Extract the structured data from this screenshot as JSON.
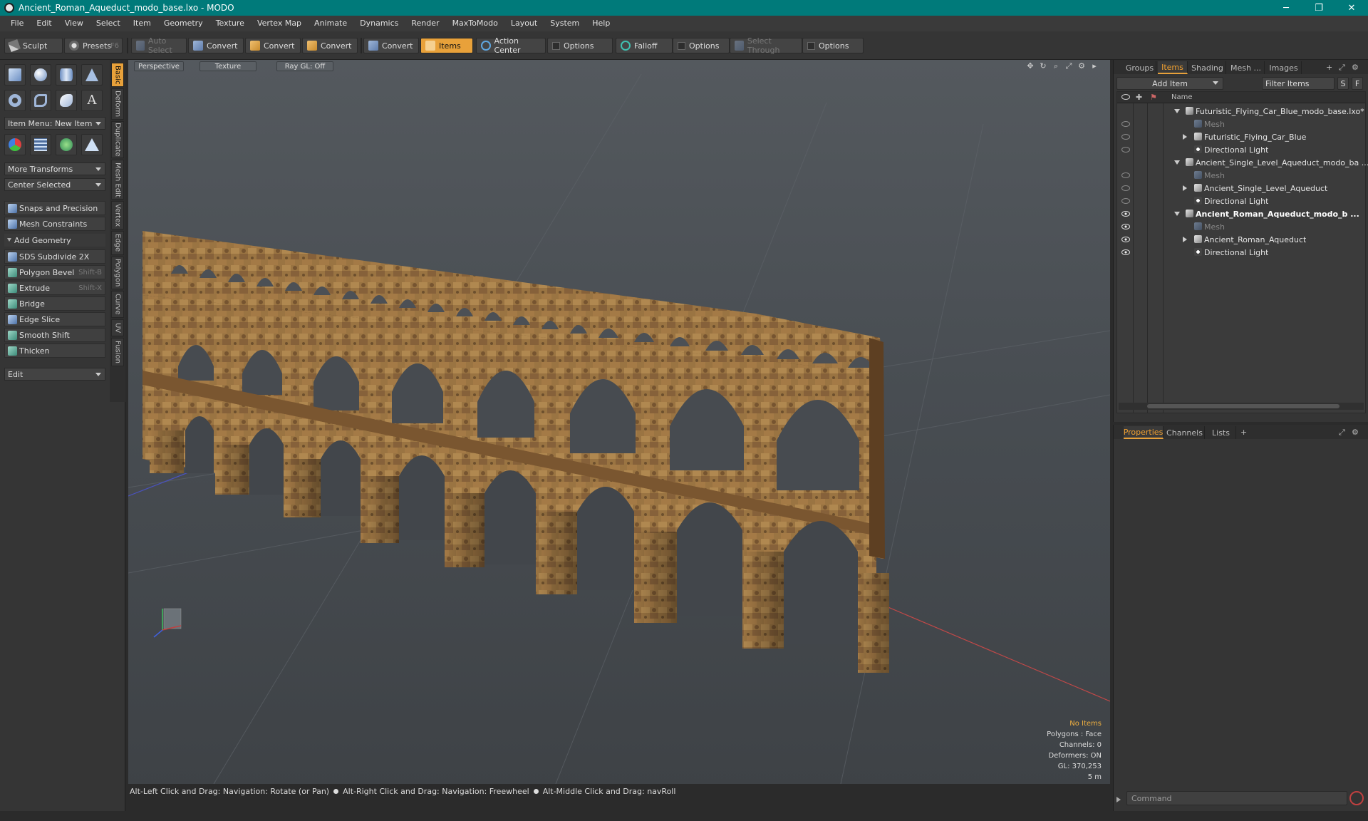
{
  "window": {
    "title": "Ancient_Roman_Aqueduct_modo_base.lxo - MODO",
    "minimize": "─",
    "maximize": "❐",
    "close": "✕"
  },
  "menu": [
    "File",
    "Edit",
    "View",
    "Select",
    "Item",
    "Geometry",
    "Texture",
    "Vertex Map",
    "Animate",
    "Dynamics",
    "Render",
    "MaxToModo",
    "Layout",
    "System",
    "Help"
  ],
  "toolbar": {
    "sculpt": "Sculpt",
    "presets": "Presets",
    "presets_key": "F6",
    "auto_select": "Auto Select",
    "convert1": "Convert",
    "convert2": "Convert",
    "convert3": "Convert",
    "convert4": "Convert",
    "items": "Items",
    "action_center": "Action Center",
    "options1": "Options",
    "falloff": "Falloff",
    "options2": "Options",
    "select_through": "Select Through",
    "options3": "Options"
  },
  "left_panel": {
    "item_menu": "Item Menu: New Item",
    "more_transforms": "More Transforms",
    "center_selected": "Center Selected",
    "snaps": "Snaps and Precision",
    "mesh_constraints": "Mesh Constraints",
    "add_geometry": "Add Geometry",
    "tools": [
      {
        "label": "SDS Subdivide 2X",
        "shortcut": ""
      },
      {
        "label": "Polygon Bevel",
        "shortcut": "Shift-B"
      },
      {
        "label": "Extrude",
        "shortcut": "Shift-X"
      },
      {
        "label": "Bridge",
        "shortcut": ""
      },
      {
        "label": "Edge Slice",
        "shortcut": ""
      },
      {
        "label": "Smooth Shift",
        "shortcut": ""
      },
      {
        "label": "Thicken",
        "shortcut": ""
      }
    ],
    "edit_dropdown": "Edit",
    "vtabs": [
      "Basic",
      "Deform",
      "Duplicate",
      "Mesh Edit",
      "Vertex",
      "Edge",
      "Polygon",
      "Curve",
      "UV",
      "Fusion"
    ]
  },
  "viewport": {
    "view_mode": "Perspective",
    "shading": "Texture",
    "raygl": "Ray GL: Off",
    "info": {
      "no_items": "No Items",
      "polygons": "Polygons : Face",
      "channels": "Channels: 0",
      "deformers": "Deformers: ON",
      "gl": "GL: 370,253",
      "scale": "5 m"
    },
    "status": [
      "Alt-Left Click and Drag: Navigation: Rotate (or Pan)",
      "Alt-Right Click and Drag: Navigation: Freewheel",
      "Alt-Middle Click and Drag: navRoll"
    ],
    "colors": {
      "stone_light": "#b08850",
      "stone_dark": "#6b4a28",
      "axis_x": "#c04040",
      "axis_z": "#4050c0"
    }
  },
  "items_panel": {
    "tabs": [
      "Groups",
      "Items",
      "Shading",
      "Mesh ...",
      "Images"
    ],
    "add_item": "Add Item",
    "filter_items": "Filter Items",
    "filter_s": "S",
    "filter_f": "F",
    "name_col": "Name",
    "rows": [
      {
        "label": "Futuristic_Flying_Car_Blue_modo_base.lxo*",
        "kind": "scene"
      },
      {
        "label": "Mesh",
        "kind": "mesh"
      },
      {
        "label": "Futuristic_Flying_Car_Blue",
        "kind": "group"
      },
      {
        "label": "Directional Light",
        "kind": "light"
      },
      {
        "label": "Ancient_Single_Level_Aqueduct_modo_ba ...",
        "kind": "scene"
      },
      {
        "label": "Mesh",
        "kind": "mesh"
      },
      {
        "label": "Ancient_Single_Level_Aqueduct",
        "kind": "group"
      },
      {
        "label": "Directional Light",
        "kind": "light"
      },
      {
        "label": "Ancient_Roman_Aqueduct_modo_b ...",
        "kind": "scene"
      },
      {
        "label": "Mesh",
        "kind": "mesh"
      },
      {
        "label": "Ancient_Roman_Aqueduct",
        "kind": "group"
      },
      {
        "label": "Directional Light",
        "kind": "light"
      }
    ]
  },
  "properties_panel": {
    "tabs": [
      "Properties",
      "Channels",
      "Lists"
    ],
    "add": "+",
    "command_placeholder": "Command"
  }
}
